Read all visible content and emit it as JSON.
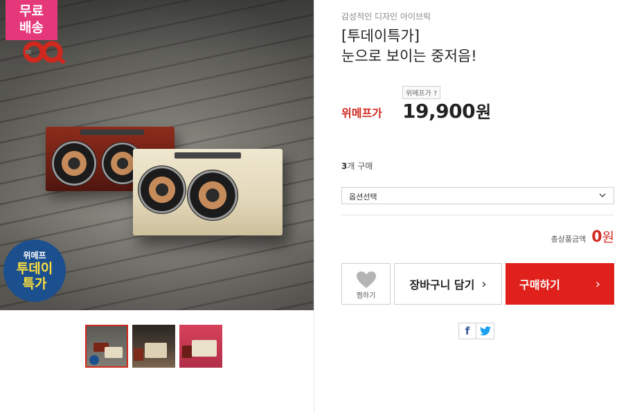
{
  "hero": {
    "free_shipping_badge": [
      "무료",
      "배송"
    ],
    "brand_logo": "brand-logo",
    "promo_badge": {
      "small": "위메프",
      "big": [
        "투데이",
        "특가"
      ]
    },
    "colors": {
      "badge_pink": "#e5387b",
      "badge_blue": "#1c4f8e",
      "badge_yellow": "#ffe03a"
    }
  },
  "thumbnails": [
    {
      "name": "thumbnail-1",
      "selected": true
    },
    {
      "name": "thumbnail-2",
      "selected": false
    },
    {
      "name": "thumbnail-3",
      "selected": false
    }
  ],
  "product": {
    "subtitle": "감성적인 디자인 아이브릭",
    "title_line1": "[투데이특가]",
    "title_line2": "눈으로 보이는 중저음!",
    "wemake_price_label": "위메프가",
    "wemake_price_help": "위메프가 ?",
    "price": "19,900",
    "price_unit": "원",
    "sold_count": "3",
    "sold_suffix": "개 구매"
  },
  "option": {
    "selected": "옵션선택",
    "icon": "chevron-down-icon"
  },
  "total": {
    "label": "총상품금액",
    "amount": "0",
    "unit": "원"
  },
  "actions": {
    "wish_label": "찜하기",
    "cart_label": "장바구니 담기",
    "buy_label": "구매하기",
    "arrow": "›"
  },
  "share": {
    "facebook": "f",
    "twitter_icon": "twitter-icon"
  },
  "colors": {
    "accent_red": "#e0211b",
    "price_red": "#d0281e",
    "border_gray": "#cfcfcf"
  }
}
